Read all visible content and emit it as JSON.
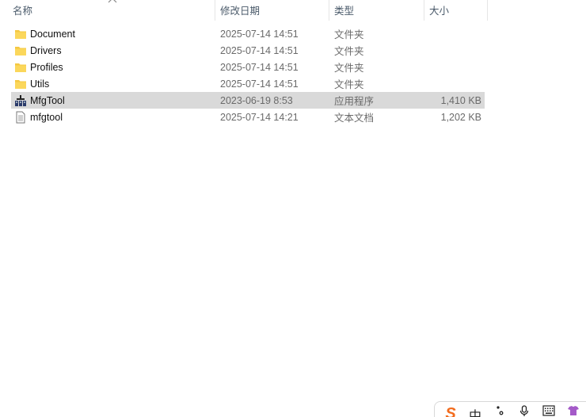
{
  "columns": {
    "name": "名称",
    "date": "修改日期",
    "type": "类型",
    "size": "大小"
  },
  "files": [
    {
      "name": "Document",
      "date": "2025-07-14 14:51",
      "type": "文件夹",
      "size": "",
      "icon": "folder-icon"
    },
    {
      "name": "Drivers",
      "date": "2025-07-14 14:51",
      "type": "文件夹",
      "size": "",
      "icon": "folder-icon"
    },
    {
      "name": "Profiles",
      "date": "2025-07-14 14:51",
      "type": "文件夹",
      "size": "",
      "icon": "folder-icon"
    },
    {
      "name": "Utils",
      "date": "2025-07-14 14:51",
      "type": "文件夹",
      "size": "",
      "icon": "folder-icon"
    },
    {
      "name": "MfgTool",
      "date": "2023-06-19 8:53",
      "type": "应用程序",
      "size": "1,410 KB",
      "icon": "application-icon",
      "selected": true
    },
    {
      "name": "mfgtool",
      "date": "2025-07-14 14:21",
      "type": "文本文档",
      "size": "1,202 KB",
      "icon": "text-document-icon"
    }
  ],
  "ime": {
    "mode_label": "中",
    "icons": [
      "sogou-logo-icon",
      "punctuation-icon",
      "microphone-icon",
      "keyboard-icon",
      "skin-icon"
    ]
  },
  "colors": {
    "selected_row": "#d9d9d9",
    "folder": "#f5c842",
    "ime_logo": "#f26b1d"
  }
}
